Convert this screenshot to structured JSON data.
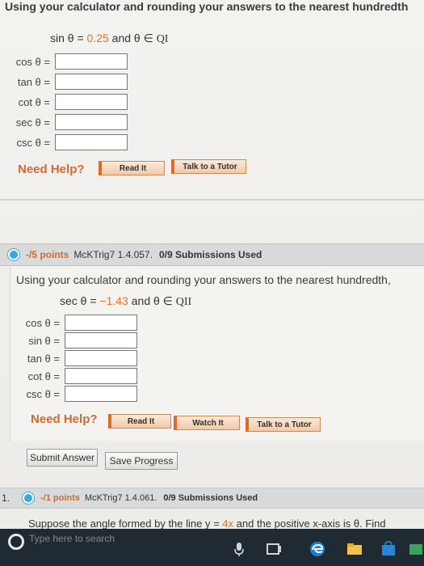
{
  "problem1": {
    "intro": "Using your calculator and rounding your answers to the nearest hundredth",
    "given_prefix": "sin θ = ",
    "given_value": "0.25",
    "given_mid": " and θ ∈ ",
    "given_quadrant": "QI",
    "rows": [
      {
        "label": "cos θ ="
      },
      {
        "label": "tan θ ="
      },
      {
        "label": "cot θ ="
      },
      {
        "label": "sec θ ="
      },
      {
        "label": "csc θ ="
      }
    ],
    "need_help": "Need Help?",
    "read_it": "Read It",
    "talk_tutor": "Talk to a Tutor"
  },
  "problem2": {
    "points": "-/5 points",
    "ref": "McKTrig7 1.4.057.",
    "submissions": "0/9 Submissions Used",
    "intro": "Using your calculator and rounding your answers to the nearest hundredth,",
    "given_prefix": "sec θ = ",
    "given_value": "−1.43",
    "given_mid": " and θ ∈ ",
    "given_quadrant": "QII",
    "rows": [
      {
        "label": "cos θ ="
      },
      {
        "label": "sin θ ="
      },
      {
        "label": "tan θ ="
      },
      {
        "label": "cot θ ="
      },
      {
        "label": "csc θ ="
      }
    ],
    "need_help": "Need Help?",
    "read_it": "Read It",
    "watch_it": "Watch It",
    "talk_tutor": "Talk to a Tutor",
    "submit": "Submit Answer",
    "save": "Save Progress"
  },
  "problem3": {
    "number": "1.",
    "points": "-/1 points",
    "ref": "McKTrig7 1.4.061.",
    "submissions": "0/9 Submissions Used",
    "text_a": "Suppose the angle formed by the line y = ",
    "text_val": "4x",
    "text_b": " and the positive x-axis is θ. Find"
  },
  "taskbar": {
    "search_placeholder": "Type here to search"
  },
  "colors": {
    "accent_orange": "#d06a33",
    "value_orange": "#e0732a",
    "dot_blue": "#39a9dc",
    "taskbar": "#1f2a33"
  }
}
